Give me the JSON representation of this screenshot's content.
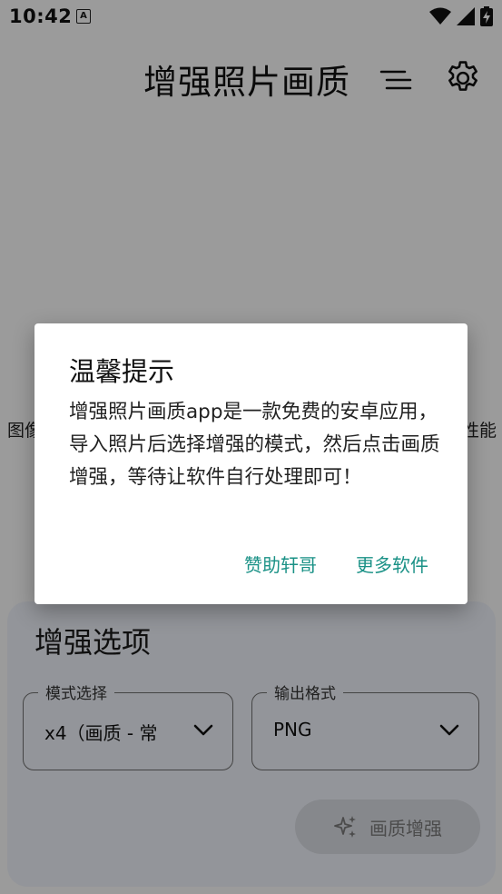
{
  "status_bar": {
    "time": "10:42",
    "notification_letter": "A"
  },
  "app": {
    "title": "增强照片画质",
    "side_text_left": "图像",
    "side_text_right": "性能"
  },
  "options": {
    "title": "增强选项",
    "mode": {
      "label": "模式选择",
      "value": "x4（画质 - 常"
    },
    "format": {
      "label": "输出格式",
      "value": "PNG"
    },
    "enhance_button": "画质增强"
  },
  "dialog": {
    "title": "温馨提示",
    "message": "增强照片画质app是一款免费的安卓应用，导入照片后选择增强的模式，然后点击画质增强，等待让软件自行处理即可！",
    "button_support": "赞助轩哥",
    "button_more": "更多软件"
  },
  "colors": {
    "accent": "#1a9186",
    "card_bg": "#eef1f8",
    "scrim": "rgba(0,0,0,0.38)"
  }
}
